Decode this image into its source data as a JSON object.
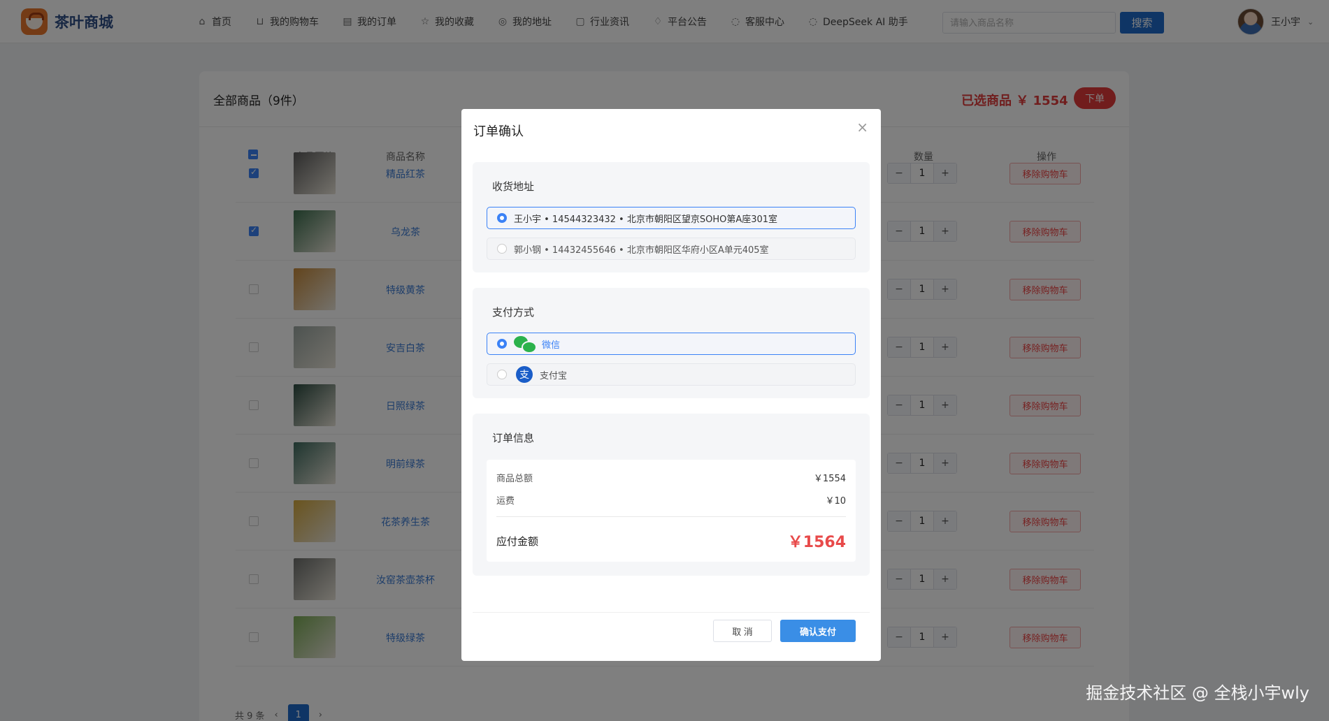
{
  "header": {
    "logo_text": "茶叶商城",
    "nav": [
      {
        "label": "首页",
        "icon": "home-icon"
      },
      {
        "label": "我的购物车",
        "icon": "cart-icon"
      },
      {
        "label": "我的订单",
        "icon": "order-icon"
      },
      {
        "label": "我的收藏",
        "icon": "star-icon"
      },
      {
        "label": "我的地址",
        "icon": "location-icon"
      },
      {
        "label": "行业资讯",
        "icon": "document-icon"
      },
      {
        "label": "平台公告",
        "icon": "bell-icon"
      },
      {
        "label": "客服中心",
        "icon": "chat-icon"
      },
      {
        "label": "DeepSeek AI 助手",
        "icon": "chat-icon"
      }
    ],
    "search_placeholder": "请输入商品名称",
    "search_button": "搜索",
    "user_name": "王小宇"
  },
  "cart": {
    "title": "全部商品（9件）",
    "selected_text": "已选商品 ￥ 1554",
    "order_button": "下单",
    "columns": {
      "image": "商品图片",
      "name": "商品名称",
      "quantity": "数量",
      "action": "操作"
    },
    "rows": [
      {
        "name": "精品红茶",
        "checked": true,
        "qty": "1",
        "color": "#5b5b5b"
      },
      {
        "name": "乌龙茶",
        "checked": true,
        "qty": "1",
        "color": "#3c6e4e"
      },
      {
        "name": "特级黄茶",
        "checked": false,
        "qty": "1",
        "color": "#c5893a"
      },
      {
        "name": "安吉白茶",
        "checked": false,
        "qty": "1",
        "color": "#9aa5a0"
      },
      {
        "name": "日照绿茶",
        "checked": false,
        "qty": "1",
        "color": "#2b4b40"
      },
      {
        "name": "明前绿茶",
        "checked": false,
        "qty": "1",
        "color": "#3d6a5e"
      },
      {
        "name": "花茶养生茶",
        "checked": false,
        "qty": "1",
        "color": "#d4a83d"
      },
      {
        "name": "汝窑茶壶茶杯",
        "checked": false,
        "qty": "1",
        "color": "#6d6f6c"
      },
      {
        "name": "特级绿茶",
        "checked": false,
        "qty": "1",
        "color": "#7aab55"
      }
    ],
    "remove_label": "移除购物车",
    "minus": "−",
    "plus": "+",
    "total_count": "共 9 条",
    "prev": "‹",
    "next": "›",
    "page": "1"
  },
  "dialog": {
    "title": "订单确认",
    "close": "×",
    "address_title": "收货地址",
    "addresses": [
      "王小宇 • 14544323432 • 北京市朝阳区望京SOHO第A座301室",
      "郭小钢 • 14432455646 • 北京市朝阳区华府小区A单元405室"
    ],
    "payment_title": "支付方式",
    "payments": [
      "微信",
      "支付宝"
    ],
    "info_title": "订单信息",
    "goods_total_label": "商品总额",
    "goods_total_value": "￥1554",
    "shipping_label": "运费",
    "shipping_value": "￥10",
    "payable_label": "应付金额",
    "payable_value": "￥1564",
    "cancel_button": "取 消",
    "confirm_button": "确认支付"
  },
  "watermark": "掘金技术社区 @ 全栈小宇wly"
}
